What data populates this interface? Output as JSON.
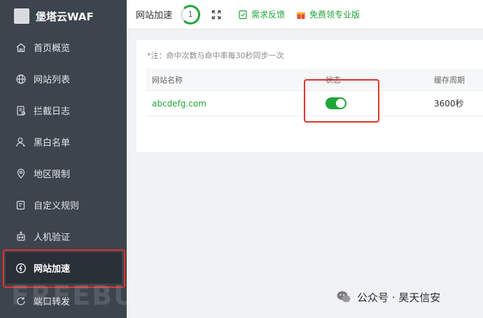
{
  "app": {
    "title": "堡塔云WAF"
  },
  "sidebar": {
    "items": [
      {
        "label": "首页概览",
        "icon": "home-icon"
      },
      {
        "label": "网站列表",
        "icon": "globe-icon"
      },
      {
        "label": "拦截日志",
        "icon": "log-icon"
      },
      {
        "label": "黑白名单",
        "icon": "user-icon"
      },
      {
        "label": "地区限制",
        "icon": "location-pin-icon"
      },
      {
        "label": "自定义规则",
        "icon": "edit-icon"
      },
      {
        "label": "人机验证",
        "icon": "robot-icon"
      },
      {
        "label": "网站加速",
        "icon": "bolt-icon",
        "active": true
      },
      {
        "label": "端口转发",
        "icon": "refresh-icon"
      }
    ]
  },
  "header": {
    "title": "网站加速",
    "badge": "1",
    "feedback_label": "需求反馈",
    "upgrade_label": "免费领专业版"
  },
  "main": {
    "note": "*注：命中次数与命中率每30秒同步一次",
    "table": {
      "columns": [
        "网站名称",
        "状态",
        "缓存周期"
      ],
      "rows": [
        {
          "site": "abcdefg.com",
          "status_on": true,
          "cache_period": "3600秒"
        }
      ]
    }
  },
  "watermark": {
    "freebuf": "FREEBUF",
    "wechat": "公众号 · 昊天信安"
  },
  "colors": {
    "accent": "#20a53a",
    "sidebar_bg": "#3c444d",
    "highlight": "#e0332e"
  }
}
